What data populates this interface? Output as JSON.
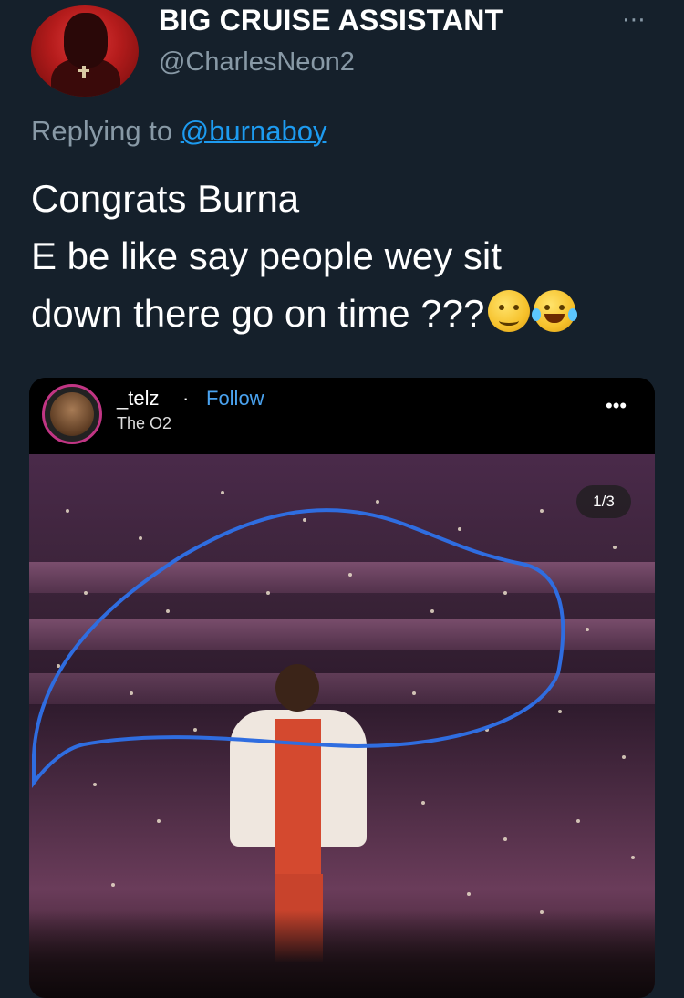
{
  "tweet": {
    "display_name": "BIG CRUISE ASSISTANT",
    "handle": "@CharlesNeon2",
    "more_label": "⋯",
    "replying_prefix": "Replying to ",
    "replying_mention": "@burnaboy",
    "text_lines": [
      "Congrats Burna",
      "E be like say people wey sit",
      "down there go on time ???"
    ],
    "emojis": [
      "woozy-face-icon",
      "face-with-tears-of-joy-icon"
    ]
  },
  "embedded_post": {
    "username": "_telz",
    "separator": "·",
    "follow_label": "Follow",
    "location": "The O2",
    "more_label": "•••",
    "counter": "1/3"
  },
  "colors": {
    "background": "#15202b",
    "secondary_text": "#8899a6",
    "link": "#1d9bf0",
    "annotation": "#2f6de0"
  }
}
